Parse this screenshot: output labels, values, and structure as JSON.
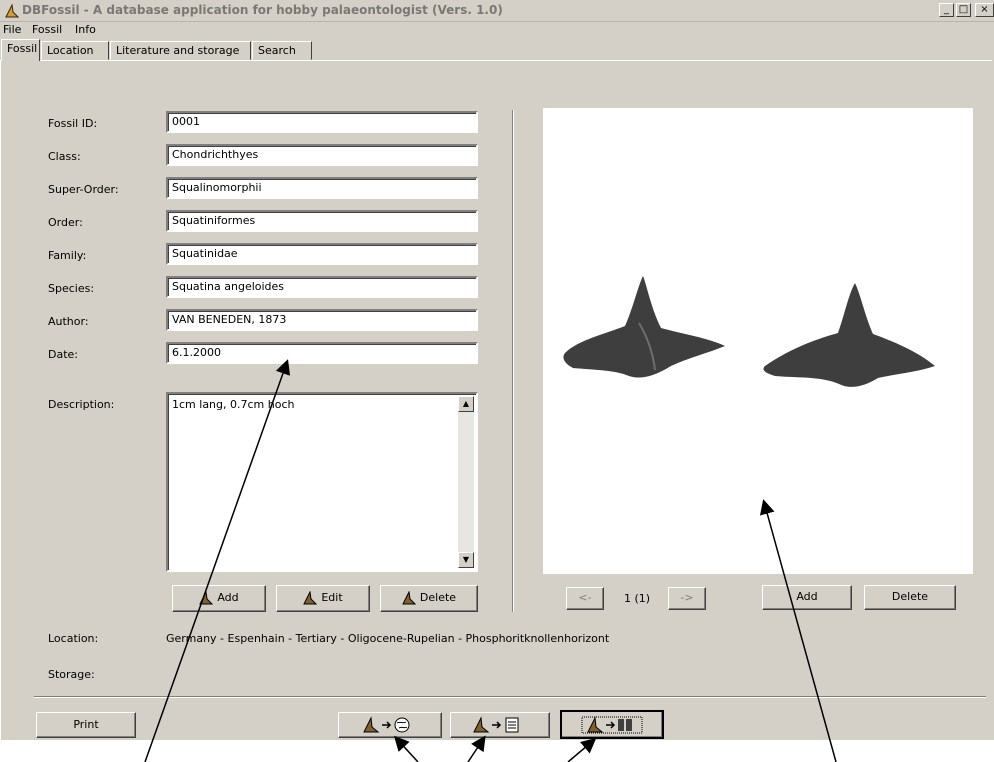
{
  "window": {
    "title": "DBFossil - A database application for hobby palaeontologist (Vers. 1.0)",
    "controls": {
      "minimize": "_",
      "maximize": "□",
      "close": "×"
    }
  },
  "menu": [
    "File",
    "Fossil",
    "Info"
  ],
  "tabs": [
    {
      "label": "Fossil",
      "active": true
    },
    {
      "label": "Location",
      "active": false
    },
    {
      "label": "Literature and storage",
      "active": false
    },
    {
      "label": "Search",
      "active": false
    }
  ],
  "form": {
    "fields": [
      {
        "label": "Fossil ID:",
        "value": "0001"
      },
      {
        "label": "Class:",
        "value": "Chondrichthyes"
      },
      {
        "label": "Super-Order:",
        "value": "Squalinomorphii"
      },
      {
        "label": "Order:",
        "value": "Squatiniformes"
      },
      {
        "label": "Family:",
        "value": "Squatinidae"
      },
      {
        "label": "Species:",
        "value": "Squatina angeloides"
      },
      {
        "label": "Author:",
        "value": "VAN BENEDEN, 1873"
      },
      {
        "label": "Date:",
        "value": "6.1.2000"
      }
    ],
    "description_label": "Description:",
    "description_value": "1cm lang, 0.7cm hoch"
  },
  "record_buttons": {
    "add": "Add",
    "edit": "Edit",
    "delete": "Delete"
  },
  "image_nav": {
    "prev": "<-",
    "counter": "1 (1)",
    "next": "->",
    "add": "Add",
    "delete": "Delete"
  },
  "info": {
    "location_label": "Location:",
    "location_value": "Germany - Espenhain - Tertiary - Oligocene-Rupelian - Phosphoritknollenhorizont",
    "storage_label": "Storage:",
    "storage_value": ""
  },
  "footer": {
    "print": "Print"
  },
  "colors": {
    "window_bg": "#d4d0c8",
    "title_text": "#7a7876",
    "field_bg": "#ffffff",
    "fossil": "#3e3e3e"
  }
}
